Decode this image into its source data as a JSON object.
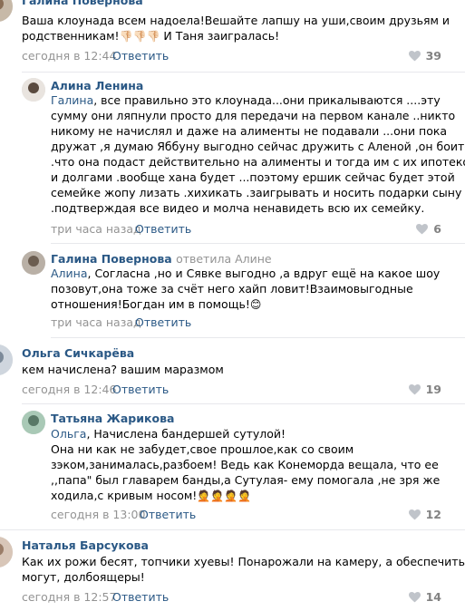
{
  "comments": [
    {
      "author": "Галина Повернова",
      "text": [
        "Ваша клоунада всем надоела!Вешайте лапшу на уши,своим друзьям и",
        "родственникам!",
        "И Таня заигралась!"
      ],
      "emoji_1": [
        "👎🏻",
        "👎🏻",
        "👎🏻"
      ],
      "date": "сегодня в 12:44",
      "reply": "Ответить",
      "likes": "39"
    },
    {
      "author": "Алина Ленина",
      "mention": "Галина",
      "text": [
        ", все правильно это клоунада...они прикалываются ....эту",
        "сумму они ляпнули просто для передачи на первом канале ..никто",
        "никому не начислял и даже на алименты не подавали ...они пока",
        "дружат ,я думаю Яббуну выгодно сейчас дружить с Аленой ,он боится",
        ".что она подаст действительно на алименты и тогда им с их ипотекой",
        "и долгами .вообще хана будет ...поэтому ершик сейчас будет этой",
        "семейке жопу лизать .хихикать .заигрывать и носить подарки сыну",
        ".подтверждая все видео и молча ненавидеть всю их семейку."
      ],
      "date": "три часа назад",
      "reply": "Ответить",
      "likes": "6"
    },
    {
      "author": "Галина Повернова",
      "replied_prefix": "ответила",
      "replied_to": "Алине",
      "mention": "Алина",
      "text": [
        ", Согласна ,но и Сявке выгодно ,а вдруг ещё на какое шоу",
        "позовут,она тоже за счёт него хайп ловит!Взаимовыгодные",
        "отношения!Богдан им в помощь!"
      ],
      "emoji_1": [
        "😊"
      ],
      "date": "три часа назад",
      "reply": "Ответить",
      "likes": ""
    },
    {
      "author": "Ольга Сичкарёва",
      "text": [
        "кем начислена? вашим маразмом"
      ],
      "date": "сегодня в 12:46",
      "reply": "Ответить",
      "likes": "19"
    },
    {
      "author": "Татьяна Жарикова",
      "mention": "Ольга",
      "text": [
        ", Начислена бандершей сутулой!",
        "Она ни как не забудет,свое прошлое,как со своим",
        "зэком,занималась,разбоем! Ведь как Конеморда вещала, что ее",
        ",,папа\" был главарем банды,а Сутулая- ему помогала ,не зря же",
        "ходила,с кривым носом!"
      ],
      "emoji_1": [
        "🤦",
        "🤦",
        "🤦",
        "🤦"
      ],
      "date": "сегодня в 13:00",
      "reply": "Ответить",
      "likes": "12"
    },
    {
      "author": "Наталья Барсукова",
      "text": [
        "Как их рожи бесят, топчики хуевы! Понарожали на камеру, а обеспечить не",
        "могут, долбоящеры!"
      ],
      "date": "сегодня в 12:57",
      "reply": "Ответить",
      "likes": "14"
    }
  ],
  "colors": {
    "link": "#2a5885",
    "meta": "#939393",
    "likes": "#828282",
    "divider": "#e7e8ec"
  },
  "icons": {
    "like": "heart-icon"
  }
}
